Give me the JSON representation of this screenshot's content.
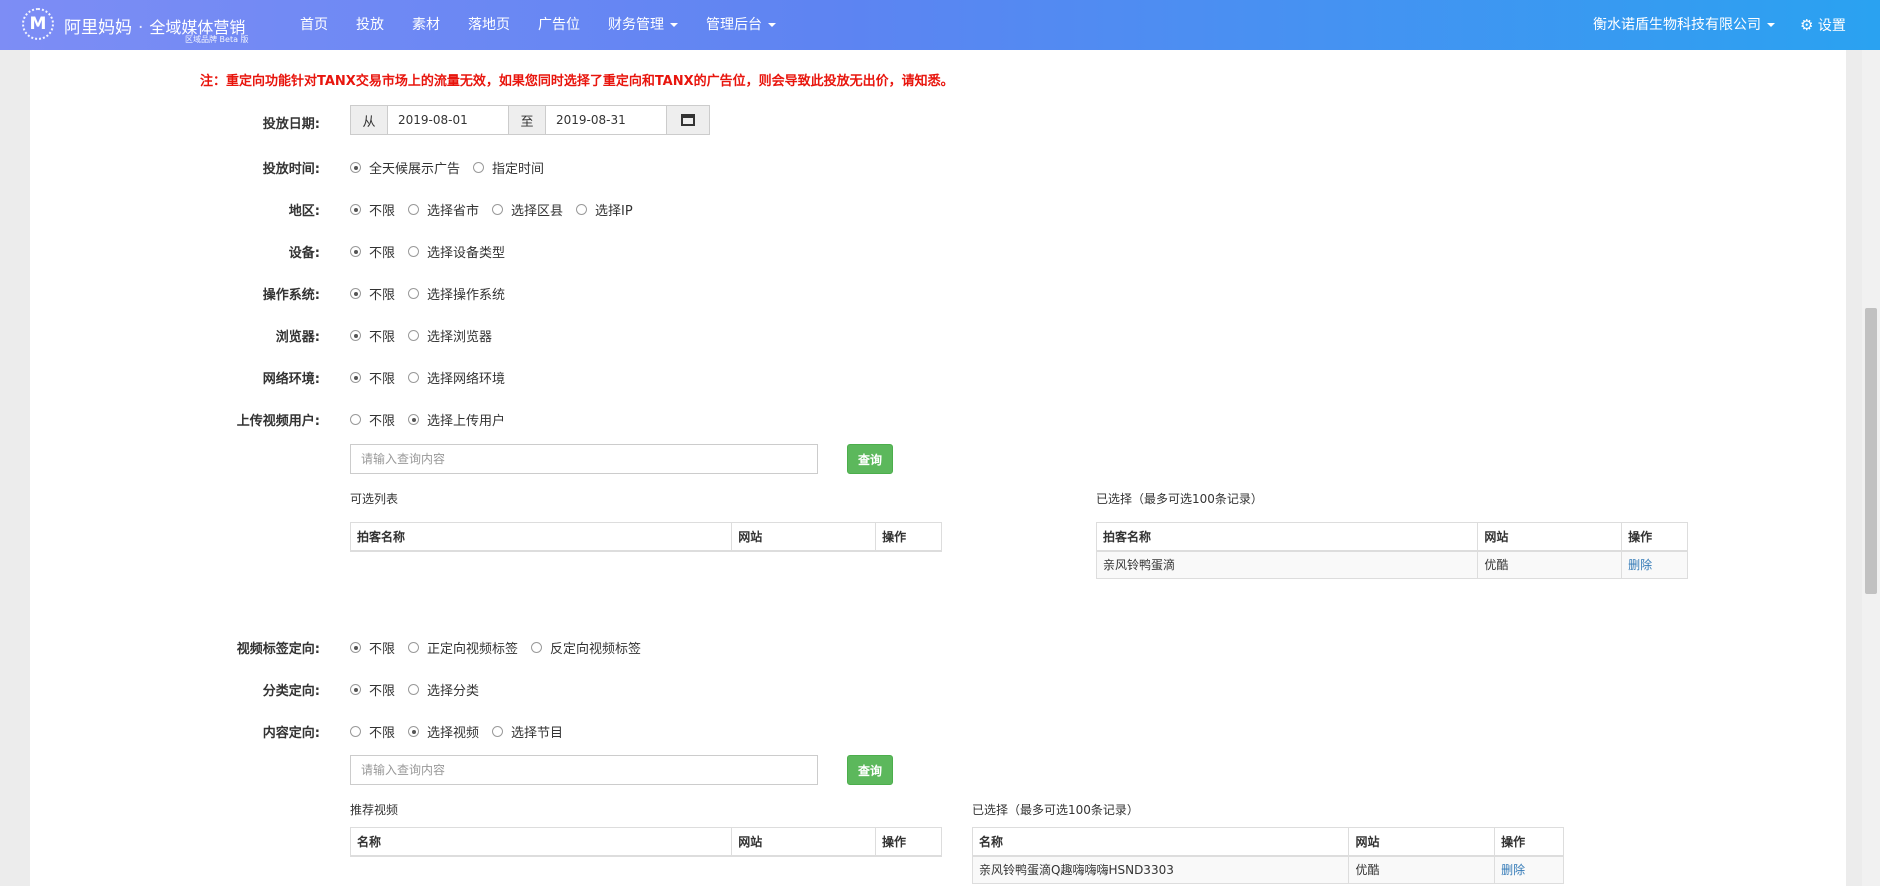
{
  "header": {
    "logo_glyph": "M",
    "brand": "阿里妈妈",
    "brand_sep": "·",
    "brand_product": "全域媒体营销",
    "brand_sub": "区域品牌 Beta 版",
    "nav": [
      {
        "label": "首页",
        "dropdown": false
      },
      {
        "label": "投放",
        "dropdown": false
      },
      {
        "label": "素材",
        "dropdown": false
      },
      {
        "label": "落地页",
        "dropdown": false
      },
      {
        "label": "广告位",
        "dropdown": false
      },
      {
        "label": "财务管理",
        "dropdown": true
      },
      {
        "label": "管理后台",
        "dropdown": true
      }
    ],
    "company": "衡水诺盾生物科技有限公司",
    "settings": "设置",
    "settings_icon": "gear-icon",
    "gradient": [
      "#7d8df5",
      "#2aa2f1"
    ]
  },
  "notice": "注：重定向功能针对TANX交易市场上的流量无效，如果您同时选择了重定向和TANX的广告位，则会导致此投放无出价，请知悉。",
  "date": {
    "label": "投放日期:",
    "from_label": "从",
    "from_value": "2019-08-01",
    "to_label": "至",
    "to_value": "2019-08-31",
    "icon": "calendar-icon"
  },
  "time": {
    "label": "投放时间:",
    "options": [
      "全天候展示广告",
      "指定时间"
    ],
    "selected": 0
  },
  "region": {
    "label": "地区:",
    "options": [
      "不限",
      "选择省市",
      "选择区县",
      "选择IP"
    ],
    "selected": 0
  },
  "device": {
    "label": "设备:",
    "options": [
      "不限",
      "选择设备类型"
    ],
    "selected": 0
  },
  "os": {
    "label": "操作系统:",
    "options": [
      "不限",
      "选择操作系统"
    ],
    "selected": 0
  },
  "browser": {
    "label": "浏览器:",
    "options": [
      "不限",
      "选择浏览器"
    ],
    "selected": 0
  },
  "network": {
    "label": "网络环境:",
    "options": [
      "不限",
      "选择网络环境"
    ],
    "selected": 0
  },
  "uploader": {
    "label": "上传视频用户:",
    "options": [
      "不限",
      "选择上传用户"
    ],
    "selected": 1,
    "search_placeholder": "请输入查询内容",
    "search_button": "查询",
    "available_caption": "可选列表",
    "available_headers": [
      "拍客名称",
      "网站",
      "操作"
    ],
    "selected_caption": "已选择（最多可选100条记录）",
    "selected_headers": [
      "拍客名称",
      "网站",
      "操作"
    ],
    "selected_rows": [
      {
        "name": "亲风铃鸭蛋滴",
        "site": "优酷",
        "action": "删除"
      }
    ]
  },
  "video_tag": {
    "label": "视频标签定向:",
    "options": [
      "不限",
      "正定向视频标签",
      "反定向视频标签"
    ],
    "selected": 0
  },
  "category": {
    "label": "分类定向:",
    "options": [
      "不限",
      "选择分类"
    ],
    "selected": 0
  },
  "content": {
    "label": "内容定向:",
    "options": [
      "不限",
      "选择视频",
      "选择节目"
    ],
    "selected": 1,
    "search_placeholder": "请输入查询内容",
    "search_button": "查询",
    "recommended_caption": "推荐视频",
    "recommended_headers": [
      "名称",
      "网站",
      "操作"
    ],
    "selected_caption": "已选择（最多可选100条记录）",
    "selected_headers": [
      "名称",
      "网站",
      "操作"
    ],
    "selected_rows": [
      {
        "name": "亲风铃鸭蛋滴Q趣嗨嗨嗨HSND3303",
        "site": "优酷",
        "action": "删除"
      }
    ]
  }
}
